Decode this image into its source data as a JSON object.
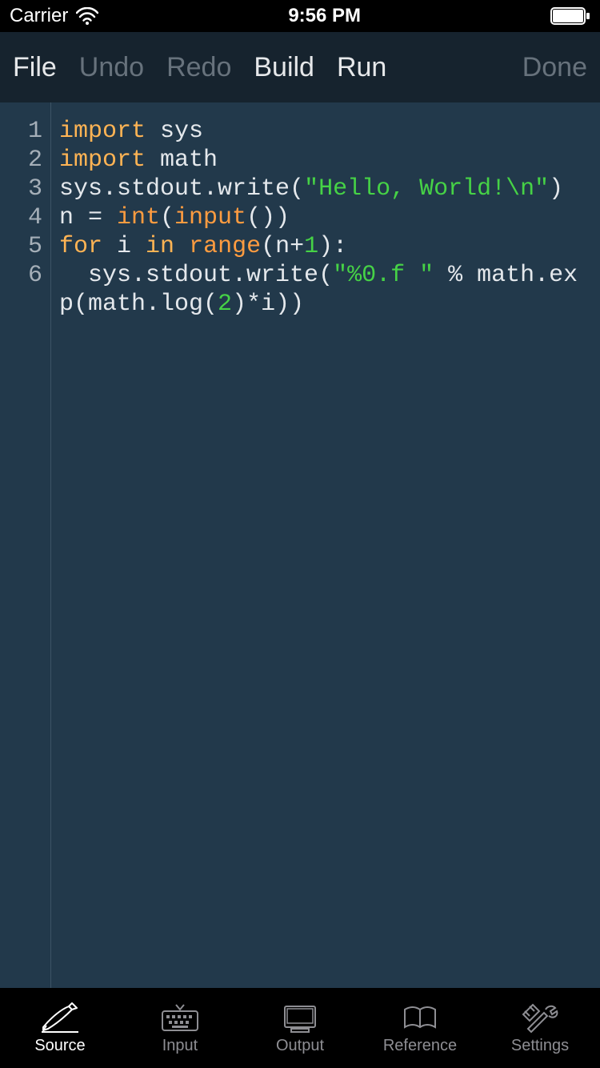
{
  "status_bar": {
    "carrier": "Carrier",
    "time": "9:56 PM"
  },
  "toolbar": {
    "file": "File",
    "undo": "Undo",
    "redo": "Redo",
    "build": "Build",
    "run": "Run",
    "done": "Done"
  },
  "editor": {
    "line_numbers": [
      "1",
      "2",
      "3",
      "4",
      "5",
      "6"
    ],
    "code": {
      "l1_import": "import",
      "l1_sys": " sys",
      "l2_import": "import",
      "l2_math": " math",
      "l3_a": "sys.stdout.write(",
      "l3_str": "\"Hello, World!\\n\"",
      "l3_b": ")",
      "l4_a": "n = ",
      "l4_int": "int",
      "l4_b": "(",
      "l4_input": "input",
      "l4_c": "())",
      "l5_for": "for",
      "l5_a": " i ",
      "l5_in": "in",
      "l5_b": " ",
      "l5_range": "range",
      "l5_c": "(n+",
      "l5_one": "1",
      "l5_d": "):",
      "l6_a": "  sys.stdout.write(",
      "l6_str": "\"%0.f \"",
      "l6_b": " % math.exp(math.log(",
      "l6_two": "2",
      "l6_c": ")*i))"
    }
  },
  "tabs": {
    "source": "Source",
    "input": "Input",
    "output": "Output",
    "reference": "Reference",
    "settings": "Settings"
  }
}
